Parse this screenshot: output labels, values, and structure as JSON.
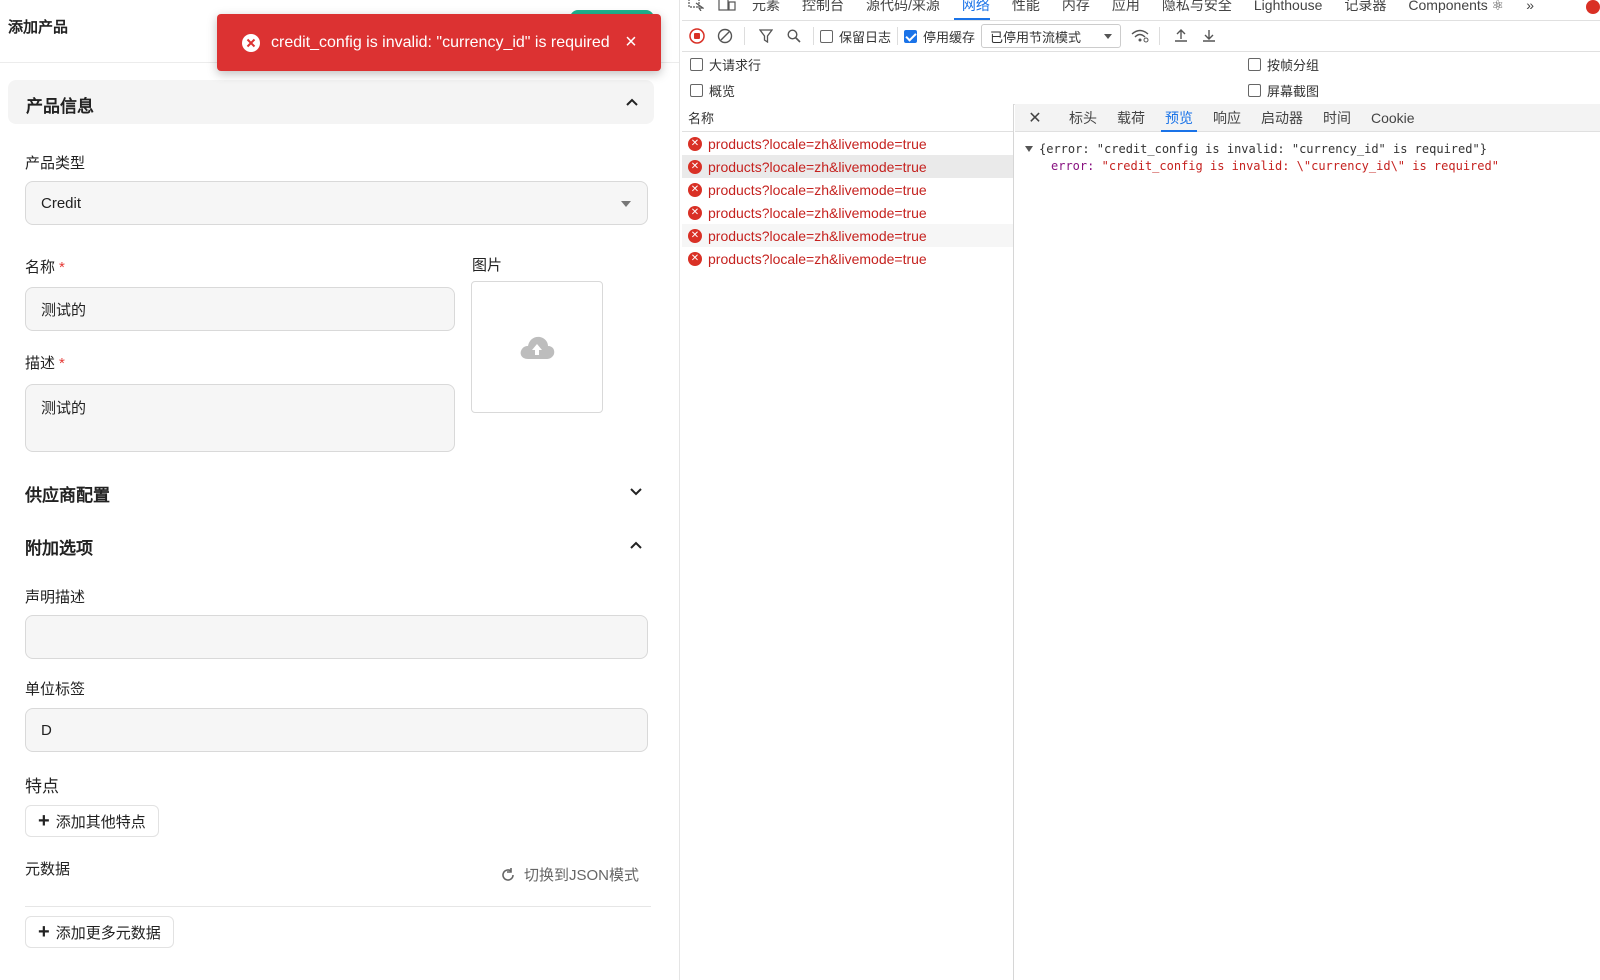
{
  "page": {
    "title": "添加产品"
  },
  "toast": {
    "message": "credit_config is invalid: \"currency_id\" is required",
    "close_glyph": "×",
    "color": "#dc3232"
  },
  "form": {
    "section_product": "产品信息",
    "product_type_label": "产品类型",
    "product_type_value": "Credit",
    "name_label": "名称",
    "required_mark": "*",
    "name_value": "测试的",
    "image_label": "图片",
    "desc_label": "描述",
    "desc_value": "测试的",
    "section_vendor": "供应商配置",
    "section_extra": "附加选项",
    "statement_label": "声明描述",
    "statement_value": "",
    "unit_label": "单位标签",
    "unit_value": "D",
    "features_label": "特点",
    "add_feature": "添加其他特点",
    "metadata_label": "元数据",
    "json_toggle": "切换到JSON模式",
    "add_metadata": "添加更多元数据",
    "plus_glyph": "+"
  },
  "devtools": {
    "tabs": [
      "元素",
      "控制台",
      "源代码/来源",
      "网络",
      "性能",
      "内存",
      "应用",
      "隐私与安全",
      "Lighthouse",
      "记录器",
      "Components ⚛"
    ],
    "active_tab": "网络",
    "more_glyph": "»",
    "toolbar": {
      "preserve_log": "保留日志",
      "disable_cache": "停用缓存",
      "throttle": "已停用节流模式"
    },
    "filters": {
      "big_rows": "大请求行",
      "group_by_frame": "按帧分组",
      "overview": "概览",
      "screenshots": "屏幕截图"
    },
    "list_header": "名称",
    "requests": [
      "products?locale=zh&livemode=true",
      "products?locale=zh&livemode=true",
      "products?locale=zh&livemode=true",
      "products?locale=zh&livemode=true",
      "products?locale=zh&livemode=true",
      "products?locale=zh&livemode=true"
    ],
    "detail_tabs": [
      "标头",
      "载荷",
      "预览",
      "响应",
      "启动器",
      "时间",
      "Cookie"
    ],
    "active_detail_tab": "预览",
    "close_glyph": "✕",
    "preview": {
      "summary": "{error: \"credit_config is invalid: \"currency_id\" is required\"}",
      "key": "error:",
      "value": "\"credit_config is invalid: \\\"currency_id\\\" is required\""
    },
    "accent_color": "#1a73e8",
    "error_color": "#c5221f"
  }
}
